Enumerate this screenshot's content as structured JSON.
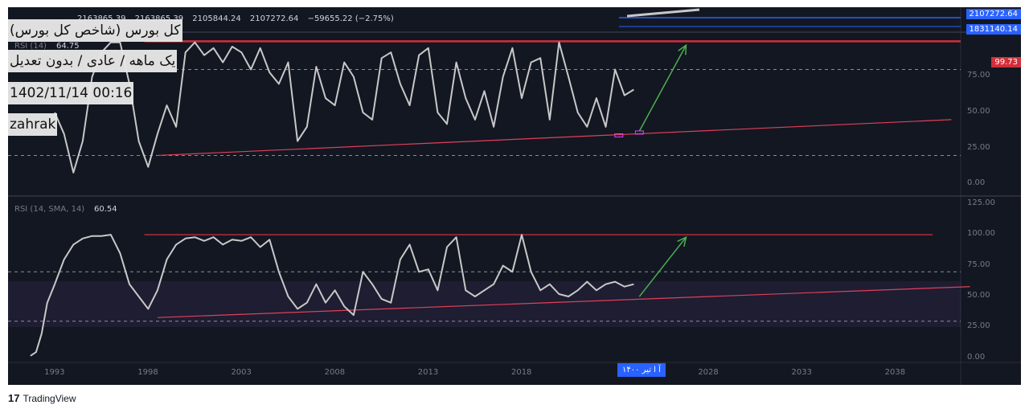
{
  "header": {
    "ohlc": [
      "2163865.39",
      "2163865.39",
      "2105844.24",
      "2107272.64",
      "−59655.22 (−2.75%)"
    ]
  },
  "info_box": {
    "line1": "کل بورس (شاخص کل بورس)",
    "line2": "یک ماهه / عادی / بدون تعدیل",
    "line3": "1402/11/14 00:16",
    "line4": "zahrak"
  },
  "price_tags": {
    "last_price": "2107272.64",
    "prev_level": "1831140.14",
    "rsi_top_level": "99.73"
  },
  "colors": {
    "background": "#131722",
    "series": "#c8c8c8",
    "resistance": "#d32f3a",
    "trendline": "#e0405a",
    "arrow": "#4caf50",
    "tag_blue": "#2962ff"
  },
  "top_indicator": {
    "label": "RSI (14)",
    "value": "64.75",
    "axis_ticks": [
      "75.00",
      "50.00",
      "25.00",
      "0.00"
    ]
  },
  "bottom_indicator": {
    "label": "RSI (14, SMA, 14)",
    "value": "60.54",
    "axis_ticks": [
      "125.00",
      "100.00",
      "75.00",
      "50.00",
      "25.00",
      "0.00"
    ]
  },
  "x_axis": {
    "ticks": [
      "1993",
      "1998",
      "2003",
      "2008",
      "2013",
      "2018",
      "2028",
      "2033",
      "2038"
    ],
    "cursor_date": "آ  ا  تیر ۱۴۰۰"
  },
  "brand": {
    "logo": "17",
    "name": "TradingView"
  },
  "chart_data": [
    {
      "type": "line",
      "title": "RSI (14)",
      "x_range": [
        1990.5,
        2041.5
      ],
      "ylim": [
        -5,
        105
      ],
      "hlines": [
        80,
        20
      ],
      "resistance_level": 99.73,
      "series": [
        {
          "x": [
            1993.0,
            1993.5,
            1994.0,
            1994.5,
            1995.0,
            1995.5,
            1996.0,
            1996.5,
            1997.0,
            1997.5,
            1998.0,
            1998.5,
            1999.0,
            1999.5,
            2000.0,
            2000.5,
            2001.0,
            2001.5,
            2002.0,
            2002.5,
            2003.0,
            2003.5,
            2004.0,
            2004.5,
            2005.0,
            2005.5,
            2006.0,
            2006.5,
            2007.0,
            2007.5,
            2008.0,
            2008.5,
            2009.0,
            2009.5,
            2010.0,
            2010.5,
            2011.0,
            2011.5,
            2012.0,
            2012.5,
            2013.0,
            2013.5,
            2014.0,
            2014.5,
            2015.0,
            2015.5,
            2016.0,
            2016.5,
            2017.0,
            2017.5,
            2018.0,
            2018.5,
            2019.0,
            2019.5,
            2020.0,
            2020.5,
            2021.0,
            2021.5,
            2022.0,
            2022.5,
            2023.0,
            2023.5,
            2024.0
          ],
          "values": [
            50,
            35,
            8,
            30,
            75,
            92,
            99,
            99,
            70,
            30,
            12,
            35,
            55,
            40,
            92,
            99,
            90,
            95,
            85,
            96,
            92,
            80,
            95,
            78,
            70,
            85,
            30,
            40,
            82,
            60,
            55,
            85,
            75,
            50,
            45,
            88,
            92,
            70,
            55,
            90,
            95,
            50,
            42,
            85,
            60,
            45,
            65,
            40,
            75,
            95,
            60,
            85,
            88,
            45,
            99,
            75,
            50,
            40,
            60,
            40,
            80,
            62,
            66
          ]
        }
      ],
      "trendline": {
        "x": [
          1998.5,
          2041.0
        ],
        "y": [
          20,
          45
        ]
      },
      "arrow": {
        "from": [
          2024.3,
          37
        ],
        "to": [
          2026.8,
          97
        ]
      },
      "markers": [
        {
          "x": 2023.2,
          "y": 34
        },
        {
          "x": 2024.3,
          "y": 36
        }
      ]
    },
    {
      "type": "line",
      "title": "RSI (14, SMA, 14)",
      "x_range": [
        1990.5,
        2041.5
      ],
      "ylim": [
        -2,
        130
      ],
      "hlines": [
        70,
        30
      ],
      "series": [
        {
          "x": [
            1991.7,
            1992.0,
            1992.3,
            1992.6,
            1993.0,
            1993.5,
            1994.0,
            1994.5,
            1995.0,
            1995.5,
            1996.0,
            1996.5,
            1997.0,
            1997.5,
            1998.0,
            1998.5,
            1999.0,
            1999.5,
            2000.0,
            2000.5,
            2001.0,
            2001.5,
            2002.0,
            2002.5,
            2003.0,
            2003.5,
            2004.0,
            2004.5,
            2005.0,
            2005.5,
            2006.0,
            2006.5,
            2007.0,
            2007.5,
            2008.0,
            2008.5,
            2009.0,
            2009.5,
            2010.0,
            2010.5,
            2011.0,
            2011.5,
            2012.0,
            2012.5,
            2013.0,
            2013.5,
            2014.0,
            2014.5,
            2015.0,
            2015.5,
            2016.0,
            2016.5,
            2017.0,
            2017.5,
            2018.0,
            2018.5,
            2019.0,
            2019.5,
            2020.0,
            2020.5,
            2021.0,
            2021.5,
            2022.0,
            2022.5,
            2023.0,
            2023.5,
            2024.0
          ],
          "values": [
            2,
            5,
            20,
            45,
            60,
            80,
            92,
            97,
            99,
            99,
            100,
            85,
            60,
            50,
            40,
            55,
            80,
            92,
            97,
            98,
            95,
            98,
            92,
            96,
            95,
            98,
            90,
            96,
            70,
            50,
            40,
            45,
            60,
            45,
            55,
            42,
            35,
            70,
            60,
            48,
            45,
            80,
            92,
            70,
            72,
            55,
            90,
            98,
            55,
            50,
            55,
            60,
            75,
            70,
            100,
            70,
            55,
            60,
            52,
            50,
            55,
            62,
            55,
            60,
            62,
            58,
            60
          ]
        }
      ],
      "resistance": {
        "x": [
          1997.8,
          2040.0
        ],
        "y": [
          100,
          100
        ]
      },
      "trendline": {
        "x": [
          1998.5,
          2042.0
        ],
        "y": [
          33,
          58
        ]
      },
      "arrow": {
        "from": [
          2024.3,
          50
        ],
        "to": [
          2026.8,
          98
        ]
      }
    }
  ]
}
